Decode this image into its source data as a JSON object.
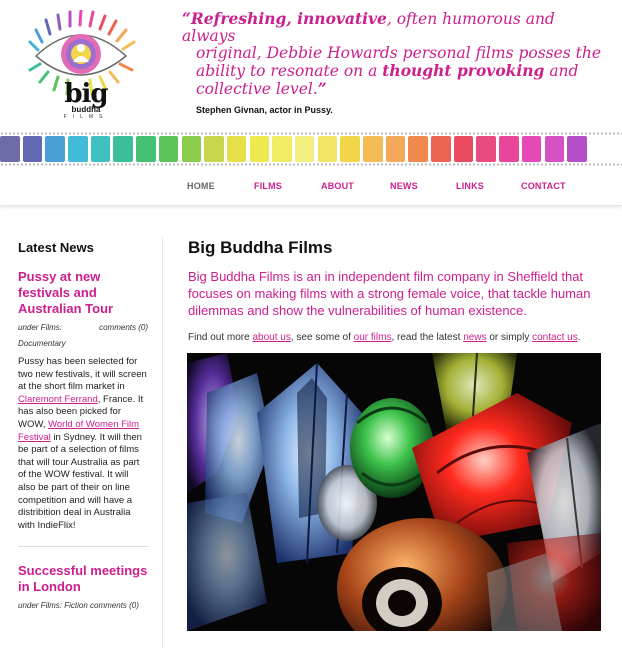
{
  "logo": {
    "big": "big",
    "buddha": "buddha",
    "films": "FILMS"
  },
  "quote": {
    "open_mark": "“",
    "strong1": "Refreshing, innovative",
    "line1_rest": ", often humorous and always",
    "line2": "original, Debbie Howards personal films posses the",
    "line3_a": "ability to resonate on a ",
    "strong2": "thought provoking",
    "line3_b": " and",
    "line4": "collective level.",
    "close_mark": "”",
    "attribution": "Stephen Givnan, actor in Pussy."
  },
  "strip": {
    "colors": [
      "#6e6ba8",
      "#5f68b0",
      "#4c9fd6",
      "#42bcd9",
      "#3fc1c2",
      "#3dbf9c",
      "#45c174",
      "#5cc25a",
      "#8bcc4c",
      "#c6d64d",
      "#e6e048",
      "#eee94f",
      "#f1ec62",
      "#f4ee7f",
      "#f2e566",
      "#f1d64a",
      "#f2bb55",
      "#f3a85a",
      "#ef8a4c",
      "#ec6353",
      "#ea4b60",
      "#e94a80",
      "#e8469a",
      "#e649b5",
      "#d452c4",
      "#b44fc7"
    ]
  },
  "nav": {
    "home": "HOME",
    "films": "FILMS",
    "about": "ABOUT",
    "news": "NEWS",
    "links": "LINKS",
    "contact": "CONTACT"
  },
  "sidebar": {
    "title": "Latest News",
    "post1": {
      "title": "Pussy at new festivals and Australian Tour",
      "meta_left": "under Films:",
      "meta_right": "comments (0)",
      "category": "Documentary",
      "t1": "Pussy has been selected for two new festivals, it will screen at the short film market in ",
      "link1": "Claremont Ferrand",
      "t2": ", France.  It has also been picked for WOW, ",
      "link2": "World of Women Film Festival",
      "t3": " in Sydney.  It will then be part of a selection of films that will tour Australia as part of the WOW festival. It will also be part of their on line competition and will have a distribition deal in Australia with IndieFlix!"
    },
    "post2": {
      "title": "Successful meetings in London",
      "meta": "under Films: Fiction comments (0)"
    }
  },
  "main": {
    "title": "Big Buddha Films",
    "intro": "Big Buddha Films is an in independent film company in Sheffield that focuses on making films with a strong female voice, that tackle human dilemmas and show the vulnerabilities of human existence.",
    "find_1": "Find out more ",
    "find_link_about": "about us",
    "find_2": ", see some of ",
    "find_link_films": "our films",
    "find_3": ", read the latest ",
    "find_link_news": "news",
    "find_4": " or simply ",
    "find_link_contact": "contact us",
    "find_5": "."
  }
}
